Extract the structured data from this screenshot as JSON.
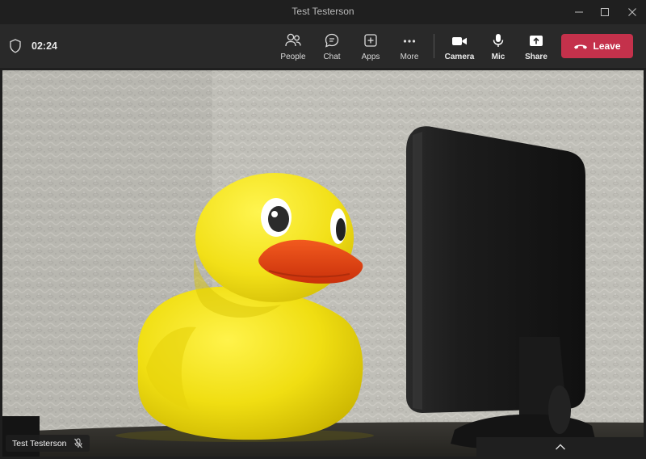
{
  "window": {
    "title": "Test Testerson",
    "controls": [
      "minimize",
      "maximize",
      "close"
    ]
  },
  "toolbar": {
    "timer": "02:24",
    "buttons": [
      {
        "label": "People",
        "icon": "people-icon"
      },
      {
        "label": "Chat",
        "icon": "chat-icon"
      },
      {
        "label": "Apps",
        "icon": "apps-icon"
      },
      {
        "label": "More",
        "icon": "more-icon"
      },
      {
        "label": "Camera",
        "icon": "camera-icon"
      },
      {
        "label": "Mic",
        "icon": "mic-icon"
      },
      {
        "label": "Share",
        "icon": "share-icon"
      }
    ],
    "leave_label": "Leave"
  },
  "video": {
    "participant_name": "Test Testerson",
    "participant_muted": true
  },
  "colors": {
    "window_bg": "#1f1f1f",
    "toolbar_bg": "#292929",
    "leave_red": "#c4314b"
  }
}
